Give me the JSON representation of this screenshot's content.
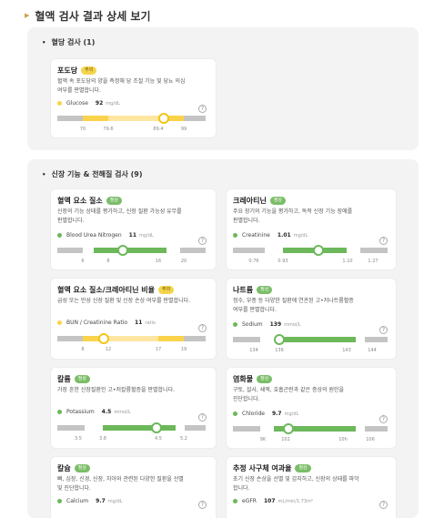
{
  "page": {
    "title": "혈액 검사 결과 상세 보기"
  },
  "sections": [
    {
      "title": "혈당 검사 (1)"
    },
    {
      "title": "신장 기능 & 전해질 검사 (9)"
    }
  ],
  "cards": [
    {
      "name": "포도당",
      "badge": "주의",
      "desc": [
        "혈액 속 포도당의 양을 측정해 당 조절 기능 및 당뇨 의심",
        "여부를 판별합니다."
      ],
      "param": "Glucose",
      "value": "92",
      "unit": "mg/dL",
      "ticks": [
        "70",
        "79.6",
        "89.4",
        "99"
      ],
      "status": "warn"
    },
    {
      "name": "혈액 요소 질소",
      "badge": "정상",
      "desc": [
        "신장의 기능 상태를 평가하고, 신장 질환 가능성 유무를",
        "판별합니다."
      ],
      "param": "Blood Urea Nitrogen",
      "value": "11",
      "unit": "mg/dL",
      "ticks": [
        "6",
        "8",
        "16",
        "20"
      ],
      "status": "normal"
    },
    {
      "name": "크레아티닌",
      "badge": "정상",
      "desc": [
        "주요 장기의 기능을 평가하고, 독적 신장 기능 장애를",
        "판별합니다."
      ],
      "param": "Creatinine",
      "value": "1.01",
      "unit": "mg/dL",
      "ticks": [
        "0.76",
        "0.93",
        "1.10",
        "1.27"
      ],
      "status": "normal"
    },
    {
      "name": "혈액 요소 질소/크레아티닌 비율",
      "badge": "주의",
      "desc": [
        "급성 또는 만성 신장 질환 및 신장 손상 여부를 판별합니다."
      ],
      "param": "BUN / Creatinine Ratio",
      "value": "11",
      "unit": "ratio",
      "ticks": [
        "8",
        "12",
        "17",
        "19"
      ],
      "status": "warn"
    },
    {
      "name": "나트륨",
      "badge": "정상",
      "desc": [
        "정수, 부종 등 다양한 질환에 연관된 고•저나트륨혈증",
        "여부를 판별합니다."
      ],
      "param": "Sodium",
      "value": "139",
      "unit": "mmol/L",
      "ticks": [
        "134",
        "136",
        "143",
        "144"
      ],
      "status": "normal"
    },
    {
      "name": "칼륨",
      "badge": "정상",
      "desc": [
        "가장 흔한 신장질환인 고•저칼륨혈증을 판별합니다."
      ],
      "param": "Potassium",
      "value": "4.5",
      "unit": "mmol/L",
      "ticks": [
        "3.5",
        "3.8",
        "4.5",
        "5.2"
      ],
      "status": "normal"
    },
    {
      "name": "염화물",
      "badge": "정상",
      "desc": [
        "구토, 설사, 쇄액, 호흡곤란과 같은 증상의 원인을",
        "진단합니다."
      ],
      "param": "Chloride",
      "value": "9.7",
      "unit": "mg/dL",
      "ticks": [
        "9K",
        "102",
        "10h",
        "106"
      ],
      "status": "normal"
    },
    {
      "name": "칼슘",
      "badge": "정상",
      "desc": [
        "뼈, 심장, 신경, 신장, 치아와 관련된 다양한 질환을 선별",
        "및 진단합니다."
      ],
      "param": "Calcium",
      "value": "9.7",
      "unit": "mg/dL",
      "ticks": [],
      "status": "normal"
    },
    {
      "name": "추정 사구체 여과율",
      "badge": "정상",
      "desc": [
        "초기 신장 손상을 선별 및 감지하고, 신장의 상태를 파악",
        "합니다."
      ],
      "param": "eGFR",
      "value": "107",
      "unit": "mL/min/1.73m²",
      "ticks": [],
      "status": "normal"
    }
  ],
  "levels": {
    "glucose_position": 0.72,
    "bun_position": 0.44,
    "creatinine_position": 0.56,
    "ratio_position": 0.31,
    "sodium_position": 0.52,
    "potassium_position": 0.67,
    "chloride_position": 0.36
  },
  "colors": {
    "normal": "#6cb85a",
    "warning": "#fbd34a",
    "out_of_range": "#c4c4c4"
  },
  "icons": {
    "help": "question-circle-icon"
  },
  "help_glyph": "?"
}
